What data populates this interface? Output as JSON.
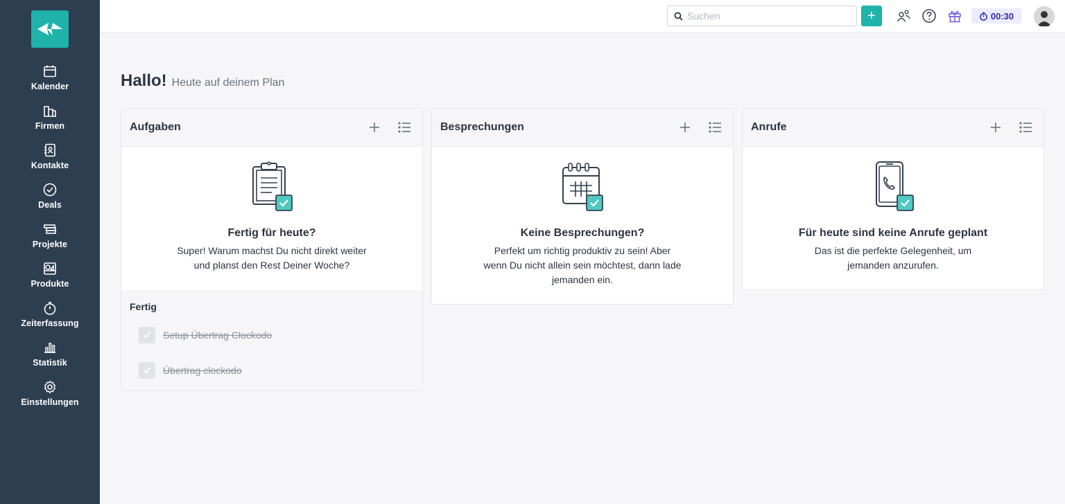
{
  "sidebar": {
    "items": [
      {
        "label": "Kalender",
        "icon": "calendar-icon"
      },
      {
        "label": "Firmen",
        "icon": "buildings-icon"
      },
      {
        "label": "Kontakte",
        "icon": "contact-book-icon"
      },
      {
        "label": "Deals",
        "icon": "check-circle-icon"
      },
      {
        "label": "Projekte",
        "icon": "project-stack-icon"
      },
      {
        "label": "Produkte",
        "icon": "products-icon"
      },
      {
        "label": "Zeiterfassung",
        "icon": "stopwatch-icon"
      },
      {
        "label": "Statistik",
        "icon": "bar-chart-icon"
      },
      {
        "label": "Einstellungen",
        "icon": "gear-icon"
      }
    ]
  },
  "topbar": {
    "search_placeholder": "Suchen",
    "add_label": "+",
    "timer": "00:30"
  },
  "greeting": {
    "title": "Hallo!",
    "subtitle": "Heute auf deinem Plan"
  },
  "cards": [
    {
      "title": "Aufgaben",
      "empty_title": "Fertig für heute?",
      "empty_text": "Super! Warum machst Du nicht direkt weiter und planst den Rest Deiner Woche?",
      "done_title": "Fertig",
      "done_items": [
        "Setup Übertrag Clockodo",
        "Übertrag clockodo"
      ]
    },
    {
      "title": "Besprechungen",
      "empty_title": "Keine Besprechungen?",
      "empty_text": "Perfekt um richtig produktiv zu sein! Aber wenn Du nicht allein sein möchtest, dann lade jemanden ein."
    },
    {
      "title": "Anrufe",
      "empty_title": "Für heute sind keine Anrufe geplant",
      "empty_text": "Das ist die perfekte Gelegenheit, um jemanden anzurufen."
    }
  ],
  "colors": {
    "sidebar": "#2d3e50",
    "accent": "#1fb3aa",
    "timer_bg": "#ecebff",
    "timer_text": "#2f2bad"
  }
}
